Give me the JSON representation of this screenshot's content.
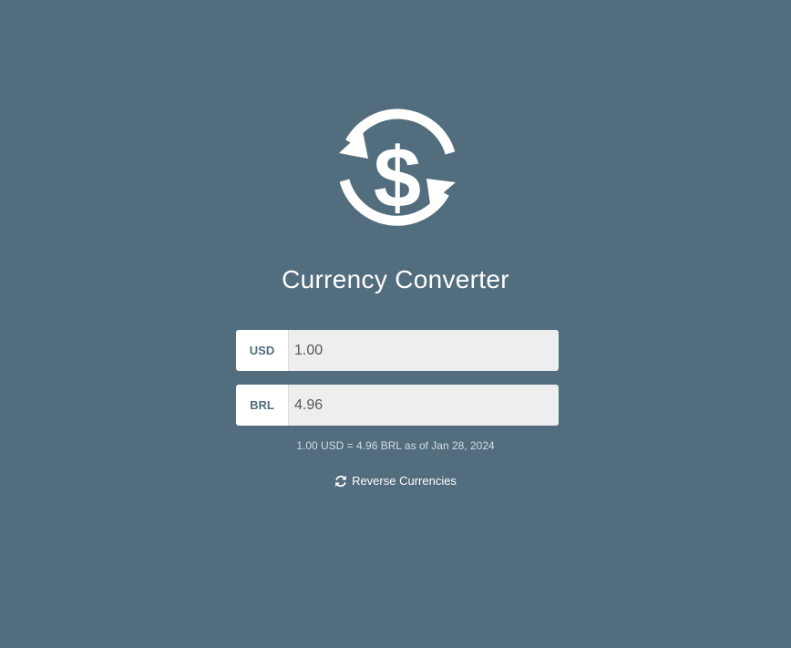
{
  "app": {
    "title": "Currency Converter",
    "logo_icon": "currency-exchange-icon"
  },
  "converter": {
    "from": {
      "code": "USD",
      "amount": "1.00"
    },
    "to": {
      "code": "BRL",
      "amount": "4.96"
    },
    "rate_text": "1.00 USD = 4.96 BRL as of Jan 28, 2024",
    "reverse_label": "Reverse Currencies",
    "reverse_icon": "refresh-icon"
  },
  "colors": {
    "background": "#526d7e",
    "input_background": "#eeeeee",
    "code_text": "#526d7e",
    "text_primary": "#ffffff"
  }
}
